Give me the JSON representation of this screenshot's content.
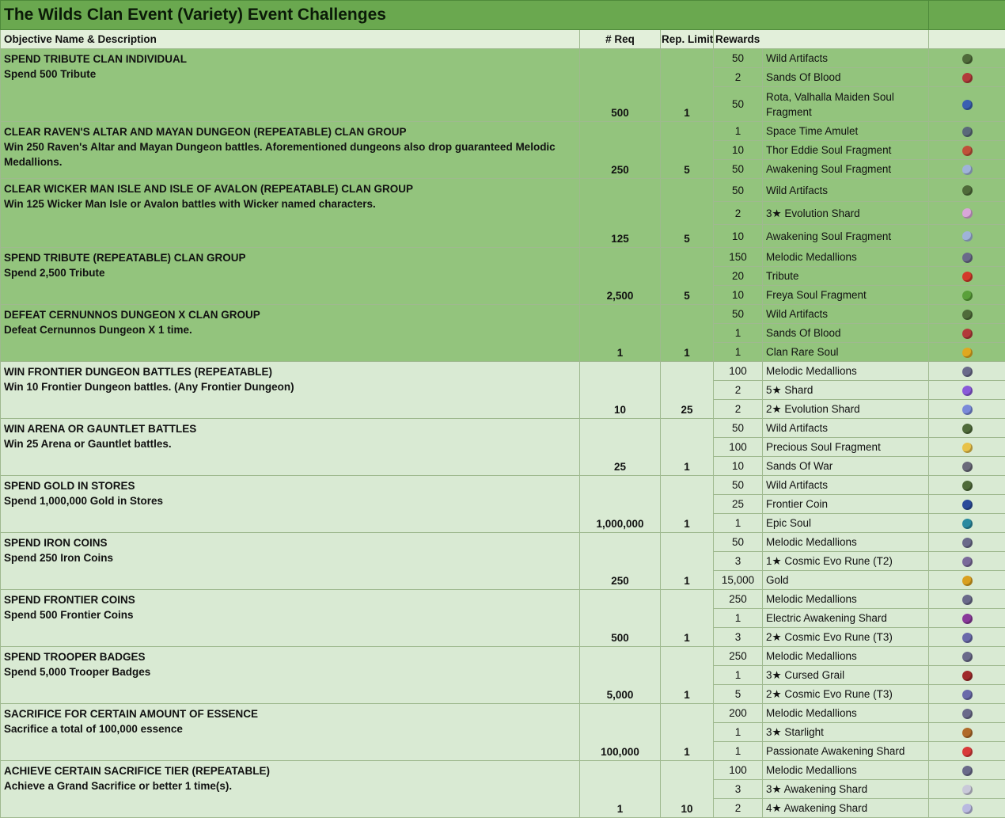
{
  "title": "The Wilds Clan Event (Variety) Event Challenges",
  "headers": {
    "objective": "Objective Name & Description",
    "req": "# Req",
    "rep": "Rep. Limit",
    "rewards": "Rewards"
  },
  "colors": {
    "dark_group": "#93c47d",
    "light_group": "#d9ead3",
    "title_bar": "#6aa84f"
  },
  "challenges": [
    {
      "title": "SPEND TRIBUTE CLAN INDIVIDUAL",
      "desc": "Spend 500 Tribute",
      "req": "500",
      "rep": "1",
      "rewards": [
        {
          "qty": "50",
          "name": "Wild Artifacts",
          "icon": "wild-artifacts-icon",
          "color": "#4f6b3a"
        },
        {
          "qty": "2",
          "name": "Sands Of Blood",
          "icon": "sands-of-blood-icon",
          "color": "#b23a3a"
        },
        {
          "qty": "50",
          "name": "Rota, Valhalla Maiden Soul Fragment",
          "icon": "soul-fragment-icon",
          "color": "#3a5fb2"
        }
      ]
    },
    {
      "title": "CLEAR RAVEN'S ALTAR AND MAYAN DUNGEON (REPEATABLE) CLAN GROUP",
      "desc": "Win 250 Raven's Altar and Mayan Dungeon battles. Aforementioned dungeons also drop guaranteed Melodic Medallions.",
      "req": "250",
      "rep": "5",
      "rewards": [
        {
          "qty": "1",
          "name": "Space Time Amulet",
          "icon": "amulet-icon",
          "color": "#5a6a7a"
        },
        {
          "qty": "10",
          "name": "Thor Eddie Soul Fragment",
          "icon": "soul-fragment-icon",
          "color": "#c0503a"
        },
        {
          "qty": "50",
          "name": "Awakening Soul Fragment",
          "icon": "soul-fragment-icon",
          "color": "#9fb3d9"
        }
      ]
    },
    {
      "title": "CLEAR WICKER MAN ISLE AND ISLE OF AVALON (REPEATABLE) CLAN GROUP",
      "desc": "Win 125 Wicker Man Isle or Avalon battles with Wicker named characters.",
      "req": "125",
      "rep": "5",
      "rewards": [
        {
          "qty": "50",
          "name": "Wild Artifacts",
          "icon": "wild-artifacts-icon",
          "color": "#4f6b3a"
        },
        {
          "qty": "2",
          "name": "3★ Evolution Shard",
          "icon": "evolution-shard-icon",
          "color": "#d9a6d9"
        },
        {
          "qty": "10",
          "name": "Awakening Soul Fragment",
          "icon": "soul-fragment-icon",
          "color": "#9fb3d9"
        }
      ]
    },
    {
      "title": "SPEND TRIBUTE (REPEATABLE) CLAN GROUP",
      "desc": "Spend 2,500 Tribute",
      "req": "2,500",
      "rep": "5",
      "rewards": [
        {
          "qty": "150",
          "name": "Melodic Medallions",
          "icon": "medallion-icon",
          "color": "#6a6a8a"
        },
        {
          "qty": "20",
          "name": "Tribute",
          "icon": "tribute-icon",
          "color": "#d33a2a"
        },
        {
          "qty": "10",
          "name": "Freya Soul Fragment",
          "icon": "soul-fragment-icon",
          "color": "#5aa03a"
        }
      ]
    },
    {
      "title": "DEFEAT CERNUNNOS DUNGEON X CLAN GROUP",
      "desc": "Defeat Cernunnos Dungeon X 1 time.",
      "req": "1",
      "rep": "1",
      "rewards": [
        {
          "qty": "50",
          "name": "Wild Artifacts",
          "icon": "wild-artifacts-icon",
          "color": "#4f6b3a"
        },
        {
          "qty": "1",
          "name": "Sands Of Blood",
          "icon": "sands-of-blood-icon",
          "color": "#b23a3a"
        },
        {
          "qty": "1",
          "name": "Clan Rare Soul",
          "icon": "rare-soul-icon",
          "color": "#e0a820"
        }
      ]
    },
    {
      "title": "WIN FRONTIER DUNGEON BATTLES (REPEATABLE)",
      "desc": "Win 10 Frontier Dungeon battles. (Any Frontier Dungeon)",
      "req": "10",
      "rep": "25",
      "rewards": [
        {
          "qty": "100",
          "name": "Melodic Medallions",
          "icon": "medallion-icon",
          "color": "#6a6a8a"
        },
        {
          "qty": "2",
          "name": "5★ Shard",
          "icon": "shard-icon",
          "color": "#8a5ad9"
        },
        {
          "qty": "2",
          "name": "2★ Evolution Shard",
          "icon": "evolution-shard-icon",
          "color": "#7a8ad9"
        }
      ]
    },
    {
      "title": "WIN ARENA OR GAUNTLET BATTLES",
      "desc": "Win 25 Arena or Gauntlet battles.",
      "req": "25",
      "rep": "1",
      "rewards": [
        {
          "qty": "50",
          "name": "Wild Artifacts",
          "icon": "wild-artifacts-icon",
          "color": "#4f6b3a"
        },
        {
          "qty": "100",
          "name": "Precious Soul Fragment",
          "icon": "soul-fragment-icon",
          "color": "#e8c24a"
        },
        {
          "qty": "10",
          "name": "Sands Of War",
          "icon": "sands-of-war-icon",
          "color": "#6a6a7a"
        }
      ]
    },
    {
      "title": "SPEND GOLD IN STORES",
      "desc": "Spend 1,000,000 Gold in Stores",
      "req": "1,000,000",
      "rep": "1",
      "rewards": [
        {
          "qty": "50",
          "name": "Wild Artifacts",
          "icon": "wild-artifacts-icon",
          "color": "#4f6b3a"
        },
        {
          "qty": "25",
          "name": "Frontier Coin",
          "icon": "frontier-coin-icon",
          "color": "#2a4a9a"
        },
        {
          "qty": "1",
          "name": "Epic Soul",
          "icon": "epic-soul-icon",
          "color": "#2a8aa0"
        }
      ]
    },
    {
      "title": "SPEND IRON COINS",
      "desc": "Spend 250 Iron Coins",
      "req": "250",
      "rep": "1",
      "rewards": [
        {
          "qty": "50",
          "name": "Melodic Medallions",
          "icon": "medallion-icon",
          "color": "#6a6a8a"
        },
        {
          "qty": "3",
          "name": "1★ Cosmic Evo Rune (T2)",
          "icon": "rune-icon",
          "color": "#7a6a9a"
        },
        {
          "qty": "15,000",
          "name": "Gold",
          "icon": "gold-icon",
          "color": "#d9a020"
        }
      ]
    },
    {
      "title": "SPEND FRONTIER COINS",
      "desc": "Spend 500 Frontier Coins",
      "req": "500",
      "rep": "1",
      "rewards": [
        {
          "qty": "250",
          "name": "Melodic Medallions",
          "icon": "medallion-icon",
          "color": "#6a6a8a"
        },
        {
          "qty": "1",
          "name": "Electric Awakening Shard",
          "icon": "awakening-shard-icon",
          "color": "#8a3a9a"
        },
        {
          "qty": "3",
          "name": "2★ Cosmic Evo Rune (T3)",
          "icon": "rune-icon",
          "color": "#6a6aaa"
        }
      ]
    },
    {
      "title": "SPEND TROOPER BADGES",
      "desc": "Spend 5,000 Trooper Badges",
      "req": "5,000",
      "rep": "1",
      "rewards": [
        {
          "qty": "250",
          "name": "Melodic Medallions",
          "icon": "medallion-icon",
          "color": "#6a6a8a"
        },
        {
          "qty": "1",
          "name": "3★ Cursed Grail",
          "icon": "grail-icon",
          "color": "#a02a2a"
        },
        {
          "qty": "5",
          "name": "2★ Cosmic Evo Rune (T3)",
          "icon": "rune-icon",
          "color": "#6a6aaa"
        }
      ]
    },
    {
      "title": "SACRIFICE FOR CERTAIN AMOUNT OF ESSENCE",
      "desc": "Sacrifice a total of 100,000 essence",
      "req": "100,000",
      "rep": "1",
      "rewards": [
        {
          "qty": "200",
          "name": "Melodic Medallions",
          "icon": "medallion-icon",
          "color": "#6a6a8a"
        },
        {
          "qty": "1",
          "name": "3★ Starlight",
          "icon": "starlight-icon",
          "color": "#b06a2a"
        },
        {
          "qty": "1",
          "name": "Passionate Awakening Shard",
          "icon": "awakening-shard-icon",
          "color": "#d93a3a"
        }
      ]
    },
    {
      "title": "ACHIEVE CERTAIN SACRIFICE TIER (REPEATABLE)",
      "desc": "Achieve a Grand Sacrifice or better 1 time(s).",
      "req": "1",
      "rep": "10",
      "rewards": [
        {
          "qty": "100",
          "name": "Melodic Medallions",
          "icon": "medallion-icon",
          "color": "#6a6a8a"
        },
        {
          "qty": "3",
          "name": "3★ Awakening Shard",
          "icon": "awakening-shard-icon",
          "color": "#c9c9d9"
        },
        {
          "qty": "2",
          "name": "4★ Awakening Shard",
          "icon": "awakening-shard-icon",
          "color": "#b9b9e0"
        }
      ]
    }
  ]
}
